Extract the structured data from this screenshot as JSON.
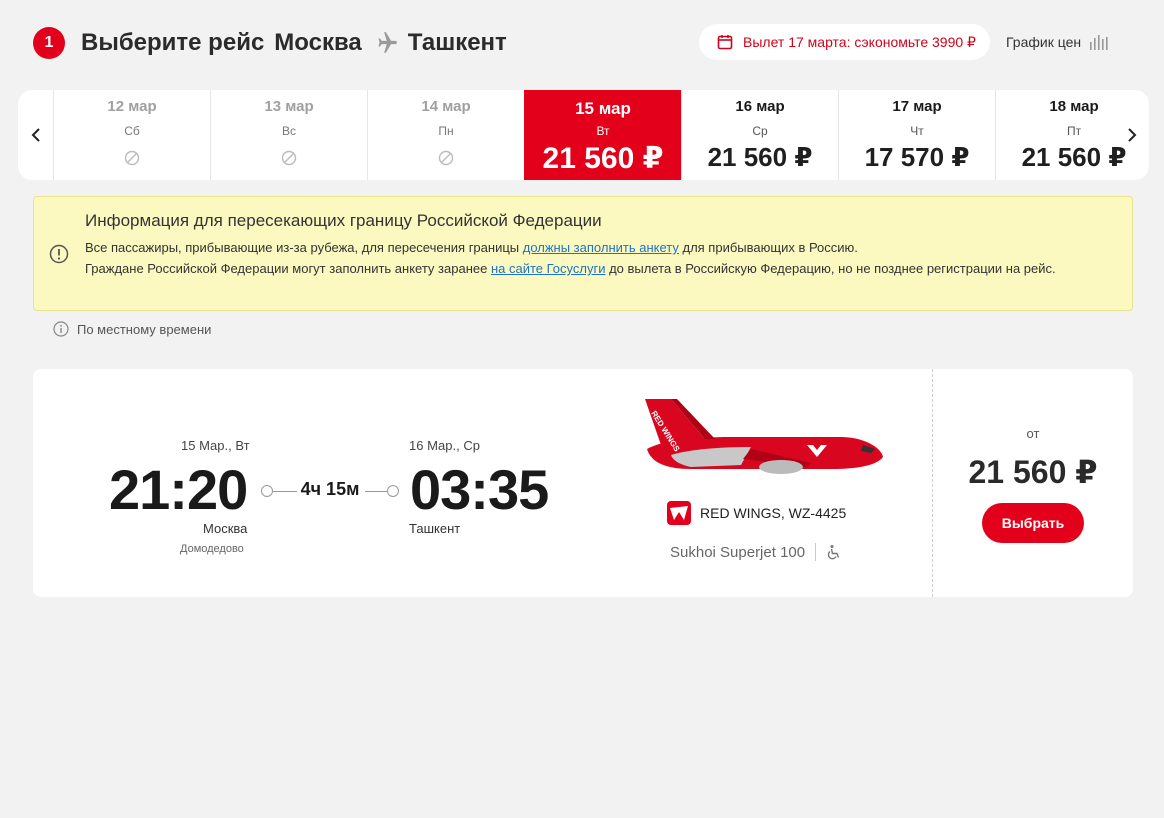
{
  "header": {
    "step": "1",
    "title_prefix": "Выберите рейс",
    "origin": "Москва",
    "destination": "Ташкент",
    "promo": "Вылет 17 марта: сэкономьте 3990 ₽",
    "price_graph": "График цен"
  },
  "date_strip": {
    "days": [
      {
        "date": "12 мар",
        "weekday": "Сб",
        "price": "",
        "available": false
      },
      {
        "date": "13 мар",
        "weekday": "Вс",
        "price": "",
        "available": false
      },
      {
        "date": "14 мар",
        "weekday": "Пн",
        "price": "",
        "available": false
      },
      {
        "date": "15 мар",
        "weekday": "Вт",
        "price": "21 560 ₽",
        "available": true,
        "selected": true
      },
      {
        "date": "16 мар",
        "weekday": "Ср",
        "price": "21 560 ₽",
        "available": true
      },
      {
        "date": "17 мар",
        "weekday": "Чт",
        "price": "17 570 ₽",
        "available": true
      },
      {
        "date": "18 мар",
        "weekday": "Пт",
        "price": "21 560 ₽",
        "available": true
      }
    ]
  },
  "info": {
    "title": "Информация для пересекающих границу Российской Федерации",
    "line1_before": "Все пассажиры, прибывающие из-за рубежа, для пересечения границы ",
    "line1_link": "должны заполнить анкету",
    "line1_after": " для прибывающих в Россию.",
    "line2_before": "Граждане Российской Федерации могут заполнить анкету заранее ",
    "line2_link": "на сайте Госуслуги",
    "line2_after": " до вылета в Российскую Федерацию, но не позднее регистрации на рейс."
  },
  "local_time_note": "По местному времени",
  "flight": {
    "departure": {
      "date": "15 Мар., Вт",
      "time": "21:20",
      "city": "Москва",
      "airport": "Домодедово"
    },
    "arrival": {
      "date": "16 Мар., Ср",
      "time": "03:35",
      "city": "Ташкент"
    },
    "duration": "4ч 15м",
    "airline": "RED WINGS, WZ-4425",
    "aircraft": "Sukhoi Superjet 100",
    "price_from_label": "от",
    "price": "21 560 ₽",
    "select_label": "Выбрать"
  },
  "colors": {
    "accent": "#e2001a",
    "info_bg": "#fbf9c0",
    "link": "#1d73c9"
  }
}
